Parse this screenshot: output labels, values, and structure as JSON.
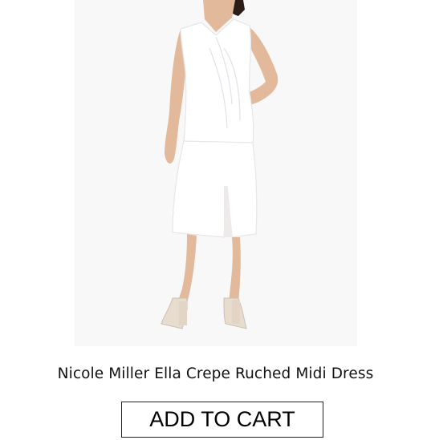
{
  "product": {
    "title": "Nicole Miller Ella Crepe Ruched Midi Dress",
    "image_subject": "model-in-white-sleeveless-midi-dress",
    "add_to_cart_label": "ADD TO CART"
  },
  "colors": {
    "image_background": "#f8f8f9",
    "dress": "#ffffff",
    "skin": "#e3b99c",
    "hair": "#2a1d17",
    "sandals": "#e8dccf",
    "button_border": "#222222",
    "text": "#111111"
  }
}
